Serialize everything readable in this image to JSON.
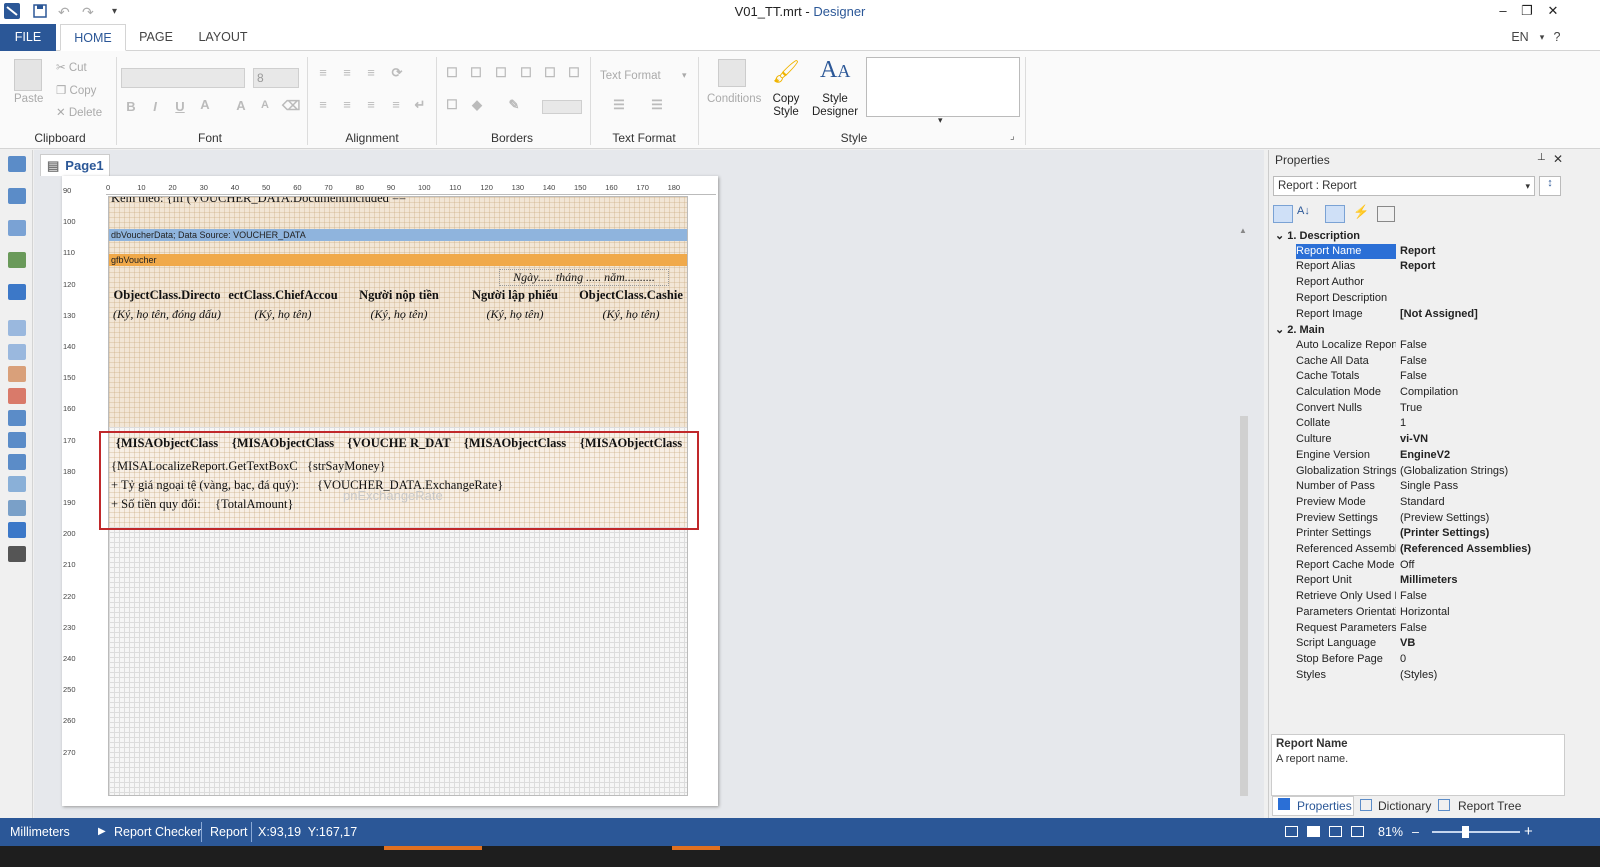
{
  "window": {
    "file_name": "V01_TT.mrt",
    "separator": " - ",
    "app_name": "Designer",
    "minimize": "–",
    "restore": "❐",
    "close": "✕"
  },
  "quick_access": {
    "save_icon": "save-icon",
    "undo_icon": "undo-icon",
    "redo_icon": "redo-icon",
    "more": "▾"
  },
  "tabs": {
    "file": "FILE",
    "home": "HOME",
    "page": "PAGE",
    "layout": "LAYOUT",
    "language": "EN",
    "help": "?"
  },
  "ribbon": {
    "clipboard": {
      "label": "Clipboard",
      "paste": "Paste",
      "cut": "Cut",
      "copy": "Copy",
      "delete": "Delete"
    },
    "font": {
      "label": "Font",
      "font_name": "",
      "font_size": "8"
    },
    "alignment": {
      "label": "Alignment"
    },
    "borders": {
      "label": "Borders"
    },
    "text_format": {
      "label": "Text Format",
      "dropdown": "Text Format"
    },
    "style": {
      "label": "Style",
      "conditions": "Conditions",
      "copy_style_1": "Copy",
      "copy_style_2": "Style",
      "style_designer_1": "Style",
      "style_designer_2": "Designer"
    }
  },
  "page_tab": {
    "label": "Page1"
  },
  "ruler": {
    "h_ticks": [
      "0",
      "10",
      "20",
      "30",
      "40",
      "50",
      "60",
      "70",
      "80",
      "90",
      "100",
      "110",
      "120",
      "130",
      "140",
      "150",
      "160",
      "170",
      "180"
    ],
    "v_ticks": [
      "90",
      "100",
      "110",
      "120",
      "130",
      "140",
      "150",
      "160",
      "170",
      "180",
      "190",
      "200",
      "210",
      "220",
      "230",
      "240",
      "250",
      "260",
      "270"
    ]
  },
  "report": {
    "top_text": "Kèm theo: {iif (VOUCHER_DATA.DocumentIncluded ==",
    "data_band": "dbVoucherData; Data Source: VOUCHER_DATA",
    "group_band": "gfbVoucher",
    "date_line": "Ngày..... tháng ..... năm..........",
    "headers": [
      "ObjectClass.Directo",
      "ectClass.ChiefAccou",
      "Người nộp tiền",
      "Người lập phiếu",
      "ObjectClass.Cashie"
    ],
    "subheaders": [
      "(Ký, họ tên, đóng dấu)",
      "(Ký, họ tên)",
      "(Ký, họ tên)",
      "(Ký, họ tên)",
      "(Ký, họ tên)"
    ],
    "names": [
      "{MISAObjectClass",
      "{MISAObjectClass",
      "{VOUCHE R_DAT",
      "{MISAObjectClass",
      "{MISAObjectClass"
    ],
    "say_money_1": "{MISALocalizeReport.GetTextBoxC",
    "say_money_2": "{strSayMoney}",
    "rate_label": "+ Tỷ giá ngoại tệ (vàng, bạc, đá quý):",
    "rate_value": "{VOUCHER_DATA.ExchangeRate}",
    "rate_panel": "pnExchangeRate",
    "amount_label": "+ Số tiền quy đổi:",
    "amount_value": "{TotalAmount}"
  },
  "properties": {
    "title": "Properties",
    "pin": "📌",
    "close": "✕",
    "object": "Report : Report",
    "cat1": "1. Description",
    "cat2": "2. Main",
    "rows1": [
      {
        "n": "Report Name",
        "v": "Report",
        "b": true,
        "sel": true
      },
      {
        "n": "Report Alias",
        "v": "Report",
        "b": true
      },
      {
        "n": "Report Author",
        "v": ""
      },
      {
        "n": "Report Description",
        "v": ""
      },
      {
        "n": "Report Image",
        "v": "[Not Assigned]",
        "b": true
      }
    ],
    "rows2": [
      {
        "n": "Auto Localize Report",
        "v": "False"
      },
      {
        "n": "Cache All Data",
        "v": "False"
      },
      {
        "n": "Cache Totals",
        "v": "False"
      },
      {
        "n": "Calculation Mode",
        "v": "Compilation"
      },
      {
        "n": "Convert Nulls",
        "v": "True"
      },
      {
        "n": "Collate",
        "v": "1"
      },
      {
        "n": "Culture",
        "v": "vi-VN",
        "b": true
      },
      {
        "n": "Engine Version",
        "v": "EngineV2",
        "b": true
      },
      {
        "n": "Globalization Strings",
        "v": "(Globalization Strings)"
      },
      {
        "n": "Number of Pass",
        "v": "Single Pass"
      },
      {
        "n": "Preview Mode",
        "v": "Standard"
      },
      {
        "n": "Preview Settings",
        "v": "(Preview Settings)"
      },
      {
        "n": "Printer Settings",
        "v": "(Printer Settings)",
        "b": true
      },
      {
        "n": "Referenced Assembl",
        "v": "(Referenced Assemblies)",
        "b": true
      },
      {
        "n": "Report Cache Mode",
        "v": "Off"
      },
      {
        "n": "Report Unit",
        "v": "Millimeters",
        "b": true
      },
      {
        "n": "Retrieve Only Used D",
        "v": "False"
      },
      {
        "n": "Parameters Orientatic",
        "v": "Horizontal"
      },
      {
        "n": "Request Parameters",
        "v": "False"
      },
      {
        "n": "Script Language",
        "v": "VB",
        "b": true
      },
      {
        "n": "Stop Before Page",
        "v": "0"
      },
      {
        "n": "Styles",
        "v": "(Styles)"
      }
    ],
    "desc_title": "Report Name",
    "desc_text": "A report name.",
    "tab_properties": "Properties",
    "tab_dictionary": "Dictionary",
    "tab_report_tree": "Report Tree"
  },
  "status": {
    "unit": "Millimeters",
    "checker": "Report Checker",
    "object": "Report",
    "coords": "X:93,19  Y:167,17",
    "zoom": "81%",
    "minus": "–",
    "plus": "+"
  },
  "colors": {
    "accent": "#2b5797",
    "selection": "#c0282a",
    "data_band": "#8fb4dd",
    "group_band": "#f0a94a"
  }
}
